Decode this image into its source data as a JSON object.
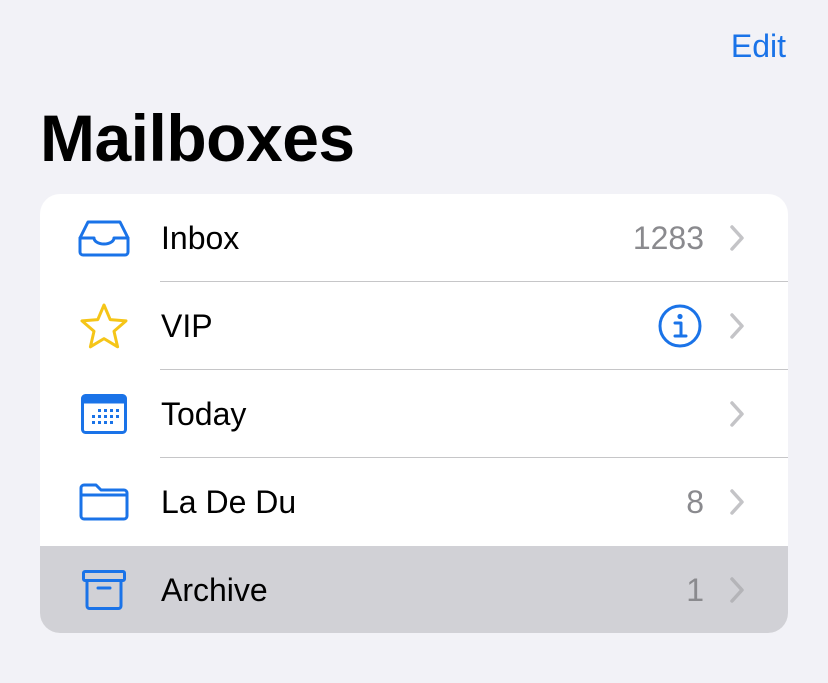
{
  "header": {
    "edit_label": "Edit",
    "title": "Mailboxes"
  },
  "colors": {
    "accent": "#1a73e8",
    "vip_star": "#f5c518",
    "selected_row": "#d1d1d6",
    "count_gray": "#8a8a8e"
  },
  "mailboxes": [
    {
      "label": "Inbox",
      "count": "1283",
      "icon": "inbox-tray-icon"
    },
    {
      "label": "VIP",
      "count": "",
      "icon": "star-icon",
      "accessory": "info-icon"
    },
    {
      "label": "Today",
      "count": "",
      "icon": "calendar-icon"
    },
    {
      "label": "La De Du",
      "count": "8",
      "icon": "folder-icon"
    },
    {
      "label": "Archive",
      "count": "1",
      "icon": "archive-box-icon",
      "selected": true
    }
  ]
}
